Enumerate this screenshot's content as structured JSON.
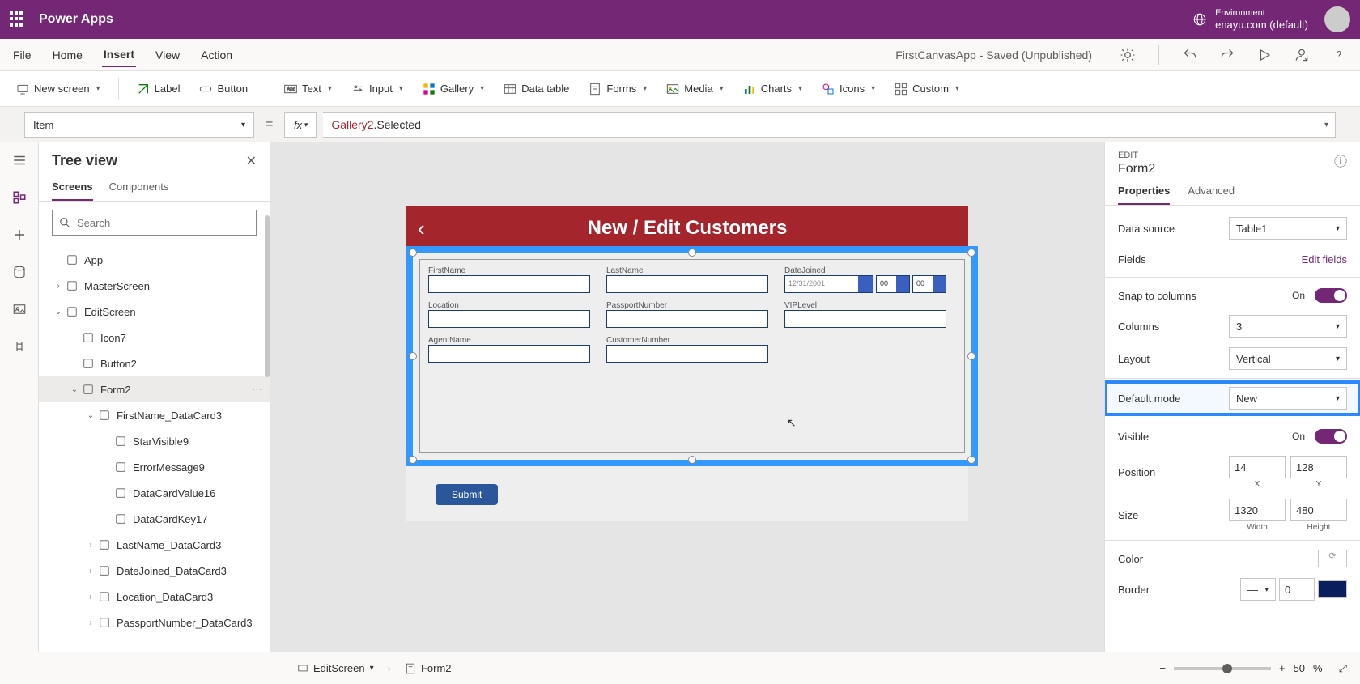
{
  "topbar": {
    "brand": "Power Apps",
    "env_label": "Environment",
    "env_value": "enayu.com (default)"
  },
  "menubar": {
    "items": [
      "File",
      "Home",
      "Insert",
      "View",
      "Action"
    ],
    "active": "Insert",
    "status": "FirstCanvasApp - Saved (Unpublished)"
  },
  "ribbon": {
    "new_screen": "New screen",
    "label": "Label",
    "button": "Button",
    "text": "Text",
    "input": "Input",
    "gallery": "Gallery",
    "data_table": "Data table",
    "forms": "Forms",
    "media": "Media",
    "charts": "Charts",
    "icons": "Icons",
    "custom": "Custom"
  },
  "formulabar": {
    "property": "Item",
    "fx": "fx",
    "formula_obj": "Gallery2",
    "formula_rest": ".Selected"
  },
  "tree": {
    "title": "Tree view",
    "tabs": [
      "Screens",
      "Components"
    ],
    "search_placeholder": "Search",
    "items": [
      {
        "label": "App",
        "level": 0,
        "caret": "",
        "icon": "app"
      },
      {
        "label": "MasterScreen",
        "level": 0,
        "caret": "›",
        "icon": "screen"
      },
      {
        "label": "EditScreen",
        "level": 0,
        "caret": "⌄",
        "icon": "screen"
      },
      {
        "label": "Icon7",
        "level": 1,
        "caret": "",
        "icon": "icon"
      },
      {
        "label": "Button2",
        "level": 1,
        "caret": "",
        "icon": "button"
      },
      {
        "label": "Form2",
        "level": 1,
        "caret": "⌄",
        "icon": "form",
        "selected": true,
        "dots": true
      },
      {
        "label": "FirstName_DataCard3",
        "level": 2,
        "caret": "⌄",
        "icon": "card"
      },
      {
        "label": "StarVisible9",
        "level": 3,
        "caret": "",
        "icon": "label"
      },
      {
        "label": "ErrorMessage9",
        "level": 3,
        "caret": "",
        "icon": "label"
      },
      {
        "label": "DataCardValue16",
        "level": 3,
        "caret": "",
        "icon": "input"
      },
      {
        "label": "DataCardKey17",
        "level": 3,
        "caret": "",
        "icon": "label"
      },
      {
        "label": "LastName_DataCard3",
        "level": 2,
        "caret": "›",
        "icon": "card"
      },
      {
        "label": "DateJoined_DataCard3",
        "level": 2,
        "caret": "›",
        "icon": "card"
      },
      {
        "label": "Location_DataCard3",
        "level": 2,
        "caret": "›",
        "icon": "card"
      },
      {
        "label": "PassportNumber_DataCard3",
        "level": 2,
        "caret": "›",
        "icon": "card"
      }
    ]
  },
  "canvas": {
    "header_title": "New / Edit Customers",
    "fields": [
      "FirstName",
      "LastName",
      "DateJoined",
      "Location",
      "PassportNumber",
      "VIPLevel",
      "AgentName",
      "CustomerNumber"
    ],
    "date_value": "12/31/2001",
    "hour": "00",
    "min": "00",
    "submit": "Submit"
  },
  "props": {
    "category": "EDIT",
    "name": "Form2",
    "tabs": [
      "Properties",
      "Advanced"
    ],
    "data_source": {
      "label": "Data source",
      "value": "Table1"
    },
    "fields": {
      "label": "Fields",
      "link": "Edit fields"
    },
    "snap": {
      "label": "Snap to columns",
      "value": "On"
    },
    "columns": {
      "label": "Columns",
      "value": "3"
    },
    "layout": {
      "label": "Layout",
      "value": "Vertical"
    },
    "default_mode": {
      "label": "Default mode",
      "value": "New"
    },
    "visible": {
      "label": "Visible",
      "value": "On"
    },
    "position": {
      "label": "Position",
      "x": "14",
      "y": "128",
      "xl": "X",
      "yl": "Y"
    },
    "size": {
      "label": "Size",
      "w": "1320",
      "h": "480",
      "wl": "Width",
      "hl": "Height"
    },
    "color": {
      "label": "Color"
    },
    "border": {
      "label": "Border",
      "value": "0"
    }
  },
  "bottombar": {
    "crumb1": "EditScreen",
    "crumb2": "Form2",
    "zoom": "50",
    "zoom_unit": "%"
  }
}
